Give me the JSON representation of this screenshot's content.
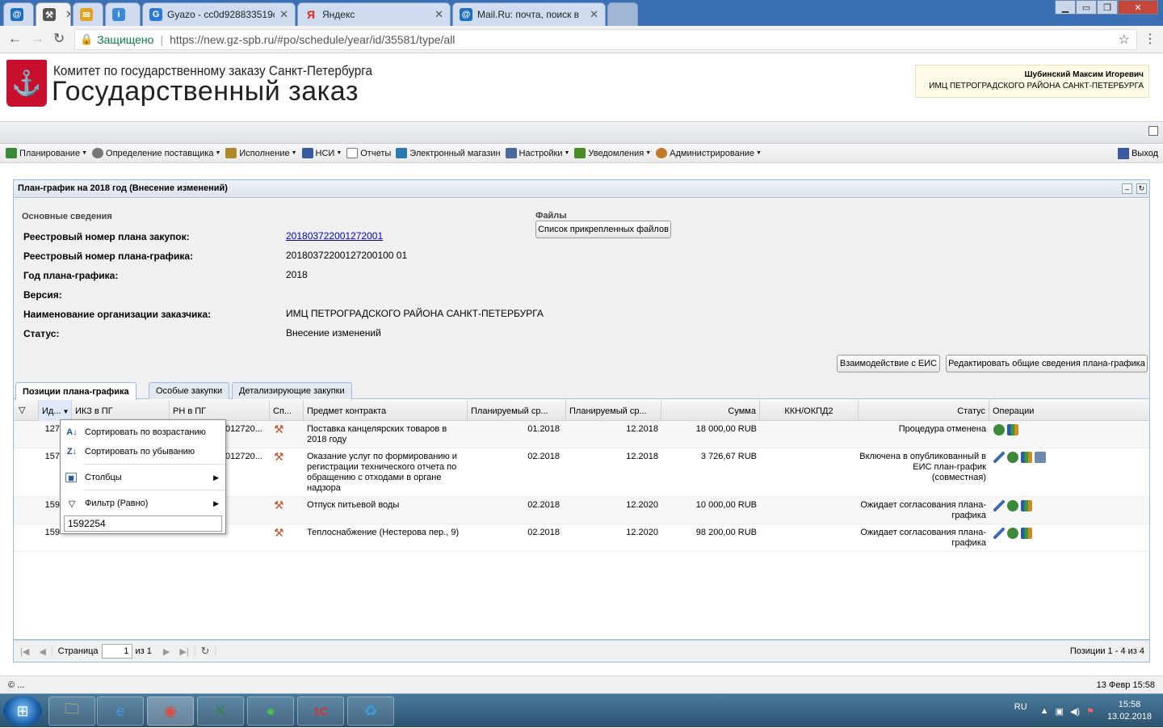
{
  "browser": {
    "tabs": [
      {
        "title": "",
        "icon": "mail-at-icon"
      },
      {
        "title": "",
        "icon": "tools-icon"
      },
      {
        "title": "",
        "icon": "envelope-icon"
      },
      {
        "title": "",
        "icon": "shield-icon"
      },
      {
        "title": "Gyazo - cc0d928833519c",
        "icon": "gyazo-icon"
      },
      {
        "title": "Яндекс",
        "icon": "yandex-icon"
      },
      {
        "title": "Mail.Ru: почта, поиск в",
        "icon": "mail-at-icon"
      }
    ],
    "secure_label": "Защищено",
    "url": "https://new.gz-spb.ru/#po/schedule/year/id/35581/type/all"
  },
  "header": {
    "org_line1": "Комитет по государственному заказу Санкт-Петербурга",
    "org_line2": "Государственный заказ",
    "user_name": "Шубинский Максим Игоревич",
    "user_org": "ИМЦ ПЕТРОГРАДСКОГО РАЙОНА САНКТ-ПЕТЕРБУРГА"
  },
  "menu": {
    "items": [
      {
        "label": "Планирование",
        "dropdown": true,
        "color": "#3a8a3a"
      },
      {
        "label": "Определение поставщика",
        "dropdown": true,
        "color": "#666666"
      },
      {
        "label": "Исполнение",
        "dropdown": true,
        "color": "#b08a2a"
      },
      {
        "label": "НСИ",
        "dropdown": true,
        "color": "#3a5aa0"
      },
      {
        "label": "Отчеты",
        "dropdown": false,
        "color": "#555555"
      },
      {
        "label": "Электронный магазин",
        "dropdown": false,
        "color": "#2a7ab0"
      },
      {
        "label": "Настройки",
        "dropdown": true,
        "color": "#4a6a9a"
      },
      {
        "label": "Уведомления",
        "dropdown": true,
        "color": "#4a8a2a"
      },
      {
        "label": "Администрирование",
        "dropdown": true,
        "color": "#c07a2a"
      }
    ],
    "logout": "Выход"
  },
  "panel": {
    "title": "План-график на 2018 год (Внесение изменений)",
    "section_main": "Основные сведения",
    "section_files": "Файлы",
    "files_button": "Список прикрепленных файлов",
    "fields": [
      {
        "label": "Реестровый номер плана закупок:",
        "value": "201803722001272001",
        "link": true
      },
      {
        "label": "Реестровый номер плана-графика:",
        "value": "20180372200127200100 01",
        "link": false
      },
      {
        "label": "Год плана-графика:",
        "value": "2018",
        "link": false
      },
      {
        "label": "Версия:",
        "value": "",
        "link": false
      },
      {
        "label": "Наименование организации заказчика:",
        "value": "ИМЦ ПЕТРОГРАДСКОГО РАЙОНА САНКТ-ПЕТЕРБУРГА",
        "link": false
      },
      {
        "label": "Статус:",
        "value": "Внесение изменений",
        "link": false
      }
    ],
    "btn_eis": "Взаимодействие с ЕИС",
    "btn_edit": "Редактировать общие сведения плана-графика"
  },
  "tabs": [
    {
      "label": "Позиции плана-графика",
      "selected": true
    },
    {
      "label": "Особые закупки",
      "selected": false
    },
    {
      "label": "Детализирующие закупки",
      "selected": false
    }
  ],
  "grid": {
    "columns": [
      "",
      "Ид...",
      "ИКЗ в ПГ",
      "РН в ПГ",
      "Сп...",
      "Предмет контракта",
      "Планируемый ср...",
      "Планируемый ср...",
      "Сумма",
      "ККН/ОКПД2",
      "Статус",
      "Операции"
    ],
    "rows": [
      {
        "id": "127",
        "ikz": "",
        "rn": "012720...",
        "subject": "Поставка канцелярских товаров в 2018 году",
        "start": "01.2018",
        "end": "12.2018",
        "sum": "18 000,00 RUB",
        "kkn": "",
        "status": "Процедура отменена",
        "ops": 2
      },
      {
        "id": "157",
        "ikz": "",
        "rn": "012720...",
        "subject": "Оказание услуг по формированию и регистрации технического отчета по обращению с отходами в органе надзора",
        "start": "02.2018",
        "end": "12.2018",
        "sum": "3 726,67 RUB",
        "kkn": "",
        "status": "Включена в опубликованный в ЕИС план-график (совместная)",
        "ops": 4
      },
      {
        "id": "159",
        "ikz": "",
        "rn": "",
        "subject": "Отпуск питьевой воды",
        "start": "02.2018",
        "end": "12.2020",
        "sum": "10 000,00 RUB",
        "kkn": "",
        "status": "Ожидает согласования плана-графика",
        "ops": 3
      },
      {
        "id": "159",
        "ikz": "",
        "rn": "",
        "subject": "Теплоснабжение (Нестерова пер., 9)",
        "start": "02.2018",
        "end": "12.2020",
        "sum": "98 200,00 RUB",
        "kkn": "",
        "status": "Ожидает согласования плана-графика",
        "ops": 3
      }
    ]
  },
  "context_menu": {
    "sort_asc": "Сортировать по возрастанию",
    "sort_desc": "Сортировать по убыванию",
    "columns": "Столбцы",
    "filter": "Фильтр (Равно)",
    "filter_value": "1592254"
  },
  "pager": {
    "page_label": "Страница",
    "page_value": "1",
    "of_label": "из 1",
    "summary": "Позиции 1 - 4 из 4"
  },
  "footer": {
    "left": "© ...",
    "right": "13 Февр 15:58"
  },
  "taskbar": {
    "lang": "RU",
    "time": "15:58",
    "date": "13.02.2018"
  }
}
